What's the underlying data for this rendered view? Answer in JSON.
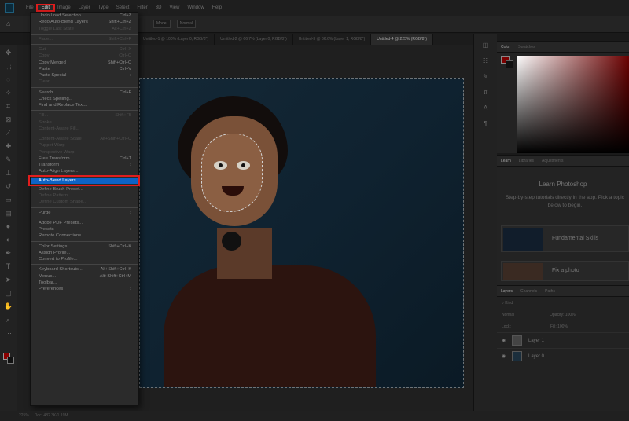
{
  "menubar": {
    "items": [
      "File",
      "Edit",
      "Image",
      "Layer",
      "Type",
      "Select",
      "Filter",
      "3D",
      "View",
      "Window",
      "Help"
    ],
    "active_index": 1
  },
  "options_bar": {
    "mode_label": "Mode:",
    "mode_value": "Normal"
  },
  "tabs": [
    "Untitled-1 @ 100% (Layer 0, RGB/8*)",
    "Untitled-2 @ 66.7% (Layer 0, RGB/8*)",
    "Untitled-3 @ 66.6% (Layer 1, RGB/8*)",
    "Untitled-4 @ 225% (RGB/8*)"
  ],
  "active_tab_index": 3,
  "edit_menu": [
    {
      "label": "Undo Load Selection",
      "shortcut": "Ctrl+Z",
      "disabled": false
    },
    {
      "label": "Redo Auto-Blend Layers",
      "shortcut": "Shift+Ctrl+Z",
      "disabled": false
    },
    {
      "label": "Toggle Last State",
      "shortcut": "Alt+Ctrl+Z",
      "disabled": true
    },
    {
      "sep": true
    },
    {
      "label": "Fade...",
      "shortcut": "Shift+Ctrl+F",
      "disabled": true
    },
    {
      "sep": true
    },
    {
      "label": "Cut",
      "shortcut": "Ctrl+X",
      "disabled": true
    },
    {
      "label": "Copy",
      "shortcut": "Ctrl+C",
      "disabled": true
    },
    {
      "label": "Copy Merged",
      "shortcut": "Shift+Ctrl+C",
      "disabled": false
    },
    {
      "label": "Paste",
      "shortcut": "Ctrl+V",
      "disabled": false
    },
    {
      "label": "Paste Special",
      "shortcut": "›",
      "disabled": false
    },
    {
      "label": "Clear",
      "shortcut": "",
      "disabled": true
    },
    {
      "sep": true
    },
    {
      "label": "Search",
      "shortcut": "Ctrl+F",
      "disabled": false
    },
    {
      "label": "Check Spelling...",
      "shortcut": "",
      "disabled": false
    },
    {
      "label": "Find and Replace Text...",
      "shortcut": "",
      "disabled": false
    },
    {
      "sep": true
    },
    {
      "label": "Fill...",
      "shortcut": "Shift+F5",
      "disabled": true
    },
    {
      "label": "Stroke...",
      "shortcut": "",
      "disabled": true
    },
    {
      "label": "Content-Aware Fill...",
      "shortcut": "",
      "disabled": true
    },
    {
      "sep": true
    },
    {
      "label": "Content-Aware Scale",
      "shortcut": "Alt+Shift+Ctrl+C",
      "disabled": true
    },
    {
      "label": "Puppet Warp",
      "shortcut": "",
      "disabled": true
    },
    {
      "label": "Perspective Warp",
      "shortcut": "",
      "disabled": true
    },
    {
      "label": "Free Transform",
      "shortcut": "Ctrl+T",
      "disabled": false
    },
    {
      "label": "Transform",
      "shortcut": "›",
      "disabled": false
    },
    {
      "label": "Auto-Align Layers...",
      "shortcut": "",
      "disabled": false
    },
    {
      "label": "Auto-Blend Layers...",
      "shortcut": "",
      "disabled": false,
      "highlight": true
    },
    {
      "label": "Define Brush Preset...",
      "shortcut": "",
      "disabled": false
    },
    {
      "label": "Define Pattern...",
      "shortcut": "",
      "disabled": true
    },
    {
      "label": "Define Custom Shape...",
      "shortcut": "",
      "disabled": true
    },
    {
      "sep": true
    },
    {
      "label": "Purge",
      "shortcut": "›",
      "disabled": false
    },
    {
      "sep": true
    },
    {
      "label": "Adobe PDF Presets...",
      "shortcut": "",
      "disabled": false
    },
    {
      "label": "Presets",
      "shortcut": "›",
      "disabled": false
    },
    {
      "label": "Remote Connections...",
      "shortcut": "",
      "disabled": false
    },
    {
      "sep": true
    },
    {
      "label": "Color Settings...",
      "shortcut": "Shift+Ctrl+K",
      "disabled": false
    },
    {
      "label": "Assign Profile...",
      "shortcut": "",
      "disabled": false
    },
    {
      "label": "Convert to Profile...",
      "shortcut": "",
      "disabled": false
    },
    {
      "sep": true
    },
    {
      "label": "Keyboard Shortcuts...",
      "shortcut": "Alt+Shift+Ctrl+K",
      "disabled": false
    },
    {
      "label": "Menus...",
      "shortcut": "Alt+Shift+Ctrl+M",
      "disabled": false
    },
    {
      "label": "Toolbar...",
      "shortcut": "",
      "disabled": false
    },
    {
      "label": "Preferences",
      "shortcut": "›",
      "disabled": false
    }
  ],
  "color_panel": {
    "tabs": [
      "Color",
      "Swatches"
    ]
  },
  "learn_panel": {
    "tabs": [
      "Learn",
      "Libraries",
      "Adjustments"
    ],
    "title": "Learn Photoshop",
    "text": "Step-by-step tutorials directly in the app. Pick a topic below to begin.",
    "cards": [
      "Fundamental Skills",
      "Fix a photo"
    ]
  },
  "layers_panel": {
    "tabs": [
      "Layers",
      "Channels",
      "Paths"
    ],
    "kind_label": "Kind",
    "blend_mode": "Normal",
    "opacity_label": "Opacity:",
    "opacity_value": "100%",
    "lock_label": "Lock:",
    "fill_label": "Fill:",
    "fill_value": "100%",
    "layers": [
      "Layer 1",
      "Layer 0"
    ]
  },
  "status": {
    "zoom": "225%",
    "doc_info": "Doc: 482.3K/1.19M"
  },
  "colors": {
    "highlight": "#0d63c6",
    "red_outline": "#e11d1d",
    "foreground": "#8a0000"
  }
}
